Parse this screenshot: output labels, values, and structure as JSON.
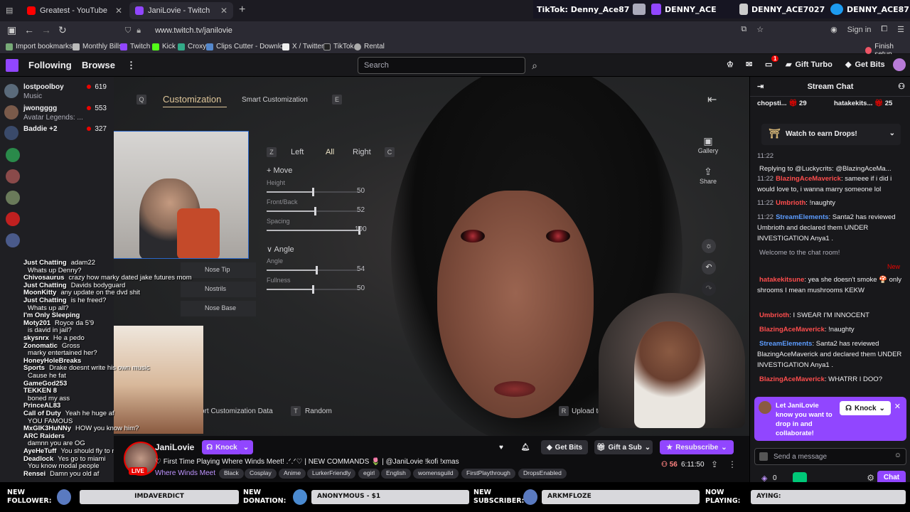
{
  "browser": {
    "tabs": [
      {
        "label": "Greatest - YouTube",
        "color": "#ff0000"
      },
      {
        "label": "JaniLovie - Twitch",
        "color": "#9146ff"
      }
    ],
    "url": "www.twitch.tv/janilovie",
    "sign_in": "Sign in",
    "bookmarks": [
      "Import bookmarks...",
      "Monthly Bills",
      "Twitch",
      "Kick",
      "Croxy",
      "Clips Cutter - Downlo...",
      "X / Twitter",
      "TikTok",
      "Rental"
    ],
    "finish_setup": "Finish setup"
  },
  "socials": {
    "tiktok": "TikTok: Denny_Ace87",
    "twitch": "DENNY_ACE",
    "youtube": "DENNY_ACE7027",
    "twitter": "DENNY_ACE87"
  },
  "twitch_nav": {
    "following": "Following",
    "browse": "Browse",
    "search_placeholder": "Search",
    "notifications_count": "1",
    "gift_turbo": "Gift Turbo",
    "get_bits": "Get Bits"
  },
  "sidebar": {
    "channels": [
      {
        "name": "lostpoolboy",
        "game": "Music",
        "viewers": "619",
        "color": "#5a6a7a"
      },
      {
        "name": "jwongggg",
        "game": "Avatar Legends: ...",
        "viewers": "553",
        "color": "#7a5a4a"
      },
      {
        "name": "Baddie +2",
        "game": "",
        "viewers": "327",
        "color": "#3a4a6a"
      }
    ]
  },
  "game_ui": {
    "tab_customization": "Customization",
    "tab_smart": "Smart Customization",
    "key_q": "Q",
    "key_e": "E",
    "key_z": "Z",
    "key_c": "C",
    "side_left": "Left",
    "side_all": "All",
    "side_right": "Right",
    "move_header": "Move",
    "angle_header": "Angle",
    "sliders_move": [
      {
        "label": "Height",
        "value": "50",
        "fraction": 0.5
      },
      {
        "label": "Front/Back",
        "value": "52",
        "fraction": 0.52
      },
      {
        "label": "Spacing",
        "value": "100",
        "fraction": 1.0
      }
    ],
    "sliders_angle": [
      {
        "label": "Angle",
        "value": "54",
        "fraction": 0.54
      },
      {
        "label": "Fullness",
        "value": "50",
        "fraction": 0.5
      }
    ],
    "nose_options": [
      "Nose Tip",
      "Nostrils",
      "Nose Base"
    ],
    "gallery": "Gallery",
    "share": "Share",
    "export": "ort Customization Data",
    "key_t": "T",
    "random": "Random",
    "key_r": "R",
    "upload": "Upload to the Ga"
  },
  "overlay_chat": [
    {
      "user": "Just Chatting",
      "msg": "adam22"
    },
    {
      "user": "",
      "msg": "Whats up Denny?"
    },
    {
      "user": "Chivosaurus",
      "msg": "crazy how marky dated jake futures mom"
    },
    {
      "user": "Just Chatting",
      "msg": "Davids bodyguard"
    },
    {
      "user": "MoonKitty",
      "msg": "any update on the dvd shit"
    },
    {
      "user": "Just Chatting",
      "msg": "is he freed?"
    },
    {
      "user": "",
      "msg": "Whats up all?"
    },
    {
      "user": "I'm Only Sleeping",
      "msg": ""
    },
    {
      "user": "Moty201",
      "msg": "Royce da 5'9"
    },
    {
      "user": "",
      "msg": "is david in jail?"
    },
    {
      "user": "skysnrx",
      "msg": "He a pedo"
    },
    {
      "user": "Zonomatic",
      "msg": "Gross"
    },
    {
      "user": "",
      "msg": "marky entertained her?"
    },
    {
      "user": "HoneyHoleBreaks",
      "msg": ""
    },
    {
      "user": "Sports",
      "msg": "Drake doesnt write his own music"
    },
    {
      "user": "",
      "msg": "Cause he fat"
    },
    {
      "user": "GameGod253",
      "msg": ""
    },
    {
      "user": "TEKKEN 8",
      "msg": ""
    },
    {
      "user": "",
      "msg": "boned my ass"
    },
    {
      "user": "PrinceAL83",
      "msg": ""
    },
    {
      "user": "Call of Duty",
      "msg": "Yeah he huge af"
    },
    {
      "user": "",
      "msg": "YOU FAMOUS"
    },
    {
      "user": "MxGIK3HuNNy",
      "msg": "HOW you know him?"
    },
    {
      "user": "ARC Raiders",
      "msg": ""
    },
    {
      "user": "",
      "msg": "damnn you are OG"
    },
    {
      "user": "AyeHeTuff",
      "msg": "You should fly to miami"
    },
    {
      "user": "Deadlock",
      "msg": "Yes go to miami"
    },
    {
      "user": "",
      "msg": "You know modal people"
    },
    {
      "user": "Rensei",
      "msg": "Damn you old af"
    }
  ],
  "stream": {
    "channel": "JaniLovie",
    "knock": "Knock",
    "live": "LIVE",
    "title": "♡ First Time Playing Where Winds Meet! .ᐟ.ᐟ♡ | NEW COMMANDS 🌷 | @JaniLovie !kofi !xmas",
    "category": "Where Winds Meet",
    "tags": [
      "Black",
      "Cosplay",
      "Anime",
      "LurkerFriendly",
      "egirl",
      "English",
      "womensguild",
      "FirstPlaythrough",
      "DropsEnabled"
    ],
    "get_bits": "Get Bits",
    "gift_sub": "Gift a Sub",
    "resubscribe": "Resubscribe",
    "viewers": "56",
    "uptime": "6:11:50"
  },
  "chat": {
    "header": "Stream Chat",
    "gifters": [
      {
        "name": "chopsti...",
        "count": "29"
      },
      {
        "name": "hatakekits...",
        "count": "25"
      }
    ],
    "drops": "Watch to earn Drops!",
    "messages": [
      {
        "time": "11:22",
        "user": "",
        "text": ""
      },
      {
        "time": "",
        "user": "",
        "text": "Replying to @Luckycrits: @BlazingAceMa..."
      },
      {
        "time": "11:22",
        "user": "BlazingAceMaverick",
        "text": ": sameee if i did i would love to, i wanna marry someone lol"
      },
      {
        "time": "11:22",
        "user": "Umbrioth",
        "text": ": !naughty"
      },
      {
        "time": "11:22",
        "user": "StreamElements",
        "text": ": Santa2 has reviewed Umbrioth and declared them UNDER INVESTIGATION Anya1 ."
      },
      {
        "time": "",
        "user": "",
        "text": "Welcome to the chat room!"
      },
      {
        "time": "",
        "user": "hatakekitsune",
        "text": ": yea she doesn't smoke 🍄 only shrooms I mean mushrooms KEKW"
      },
      {
        "time": "",
        "user": "Umbrioth",
        "text": ": I SWEAR I'M INNOCENT"
      },
      {
        "time": "",
        "user": "BlazingAceMaverick",
        "text": ": !naughty"
      },
      {
        "time": "",
        "user": "StreamElements",
        "text": ": Santa2 has reviewed BlazingAceMaverick and declared them UNDER INVESTIGATION Anya1 ."
      },
      {
        "time": "",
        "user": "BlazingAceMaverick",
        "text": ": WHATRR I DOO?"
      }
    ],
    "new_label": "New",
    "knock_prompt": "Let JaniLovie know you want to drop in and collaborate!",
    "knock_button": "Knock",
    "send_placeholder": "Send a message",
    "chat_button": "Chat"
  },
  "bottom_bar": {
    "follower_label": "NEW FOLLOWER:",
    "follower": "IMDAVERDICT",
    "donation_label": "NEW DONATION:",
    "donation": "ANONYMOUS - $1",
    "subscriber_label": "NEW SUBSCRIBER:",
    "subscriber": "ARKMFLOZE",
    "playing_label": "NOW PLAYING:",
    "playing": "AYING:"
  },
  "colors": {
    "twitch_purple": "#9146ff",
    "live_red": "#eb0400"
  }
}
